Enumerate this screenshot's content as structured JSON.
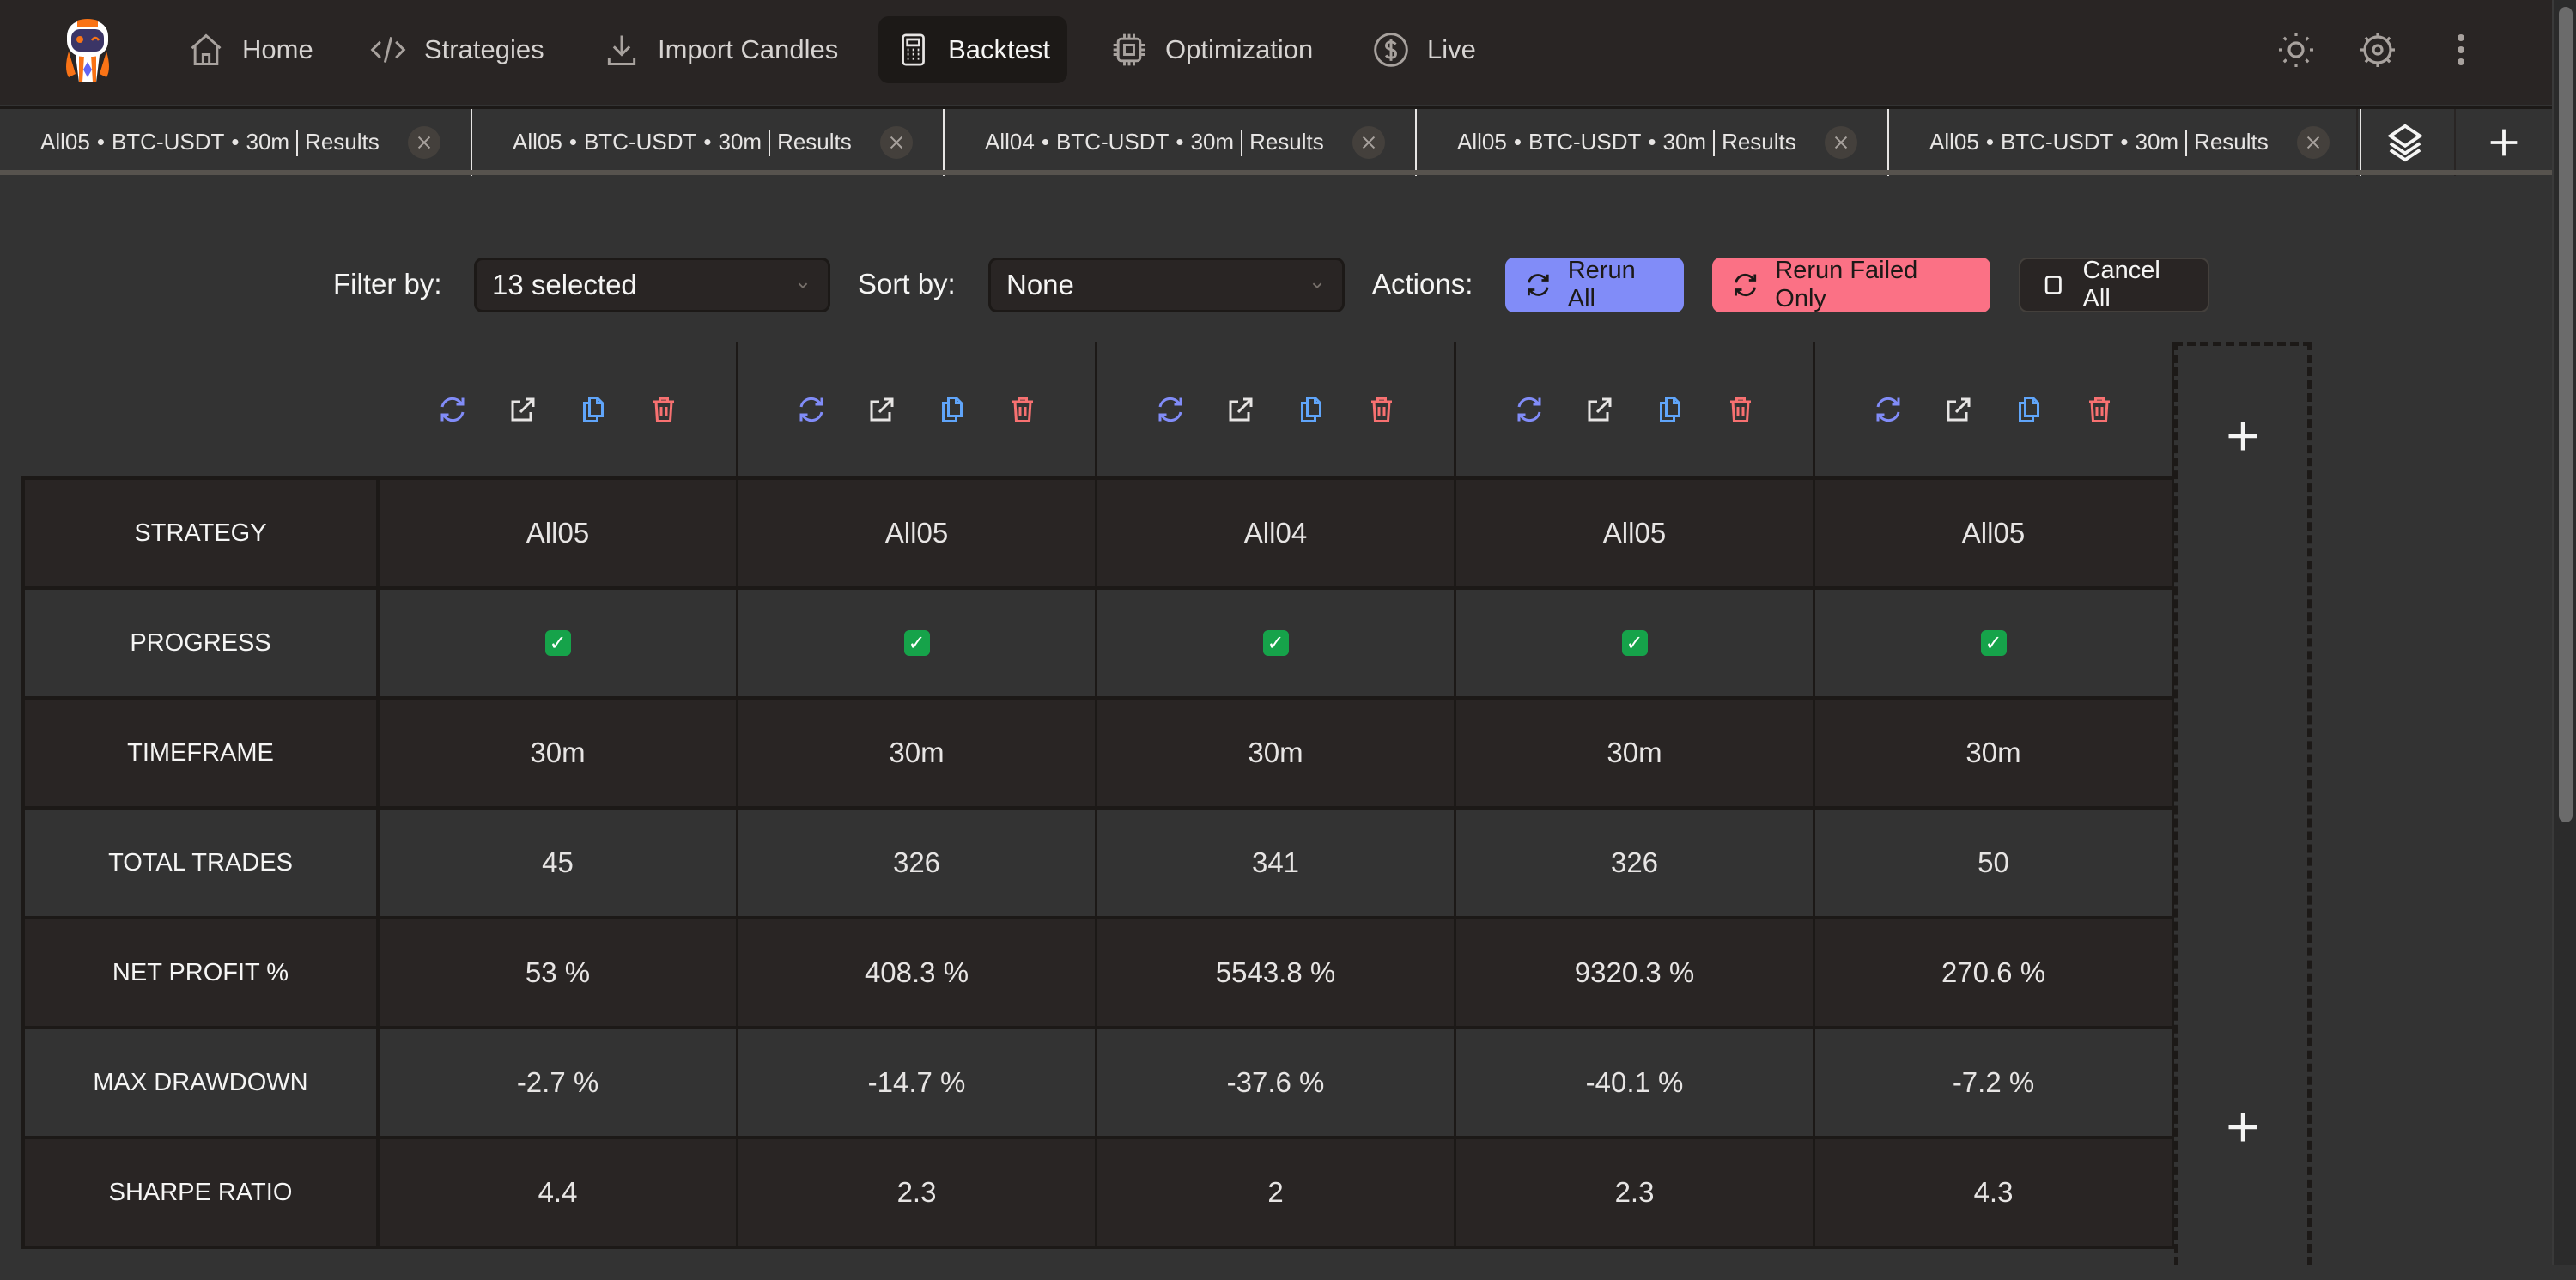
{
  "nav": {
    "items": [
      {
        "label": "Home",
        "icon": "home-icon"
      },
      {
        "label": "Strategies",
        "icon": "code-icon"
      },
      {
        "label": "Import Candles",
        "icon": "download-icon"
      },
      {
        "label": "Backtest",
        "icon": "calculator-icon",
        "active": true
      },
      {
        "label": "Optimization",
        "icon": "cpu-icon"
      },
      {
        "label": "Live",
        "icon": "dollar-icon"
      }
    ],
    "right_icons": [
      "sun-icon",
      "gear-icon",
      "more-vertical-icon"
    ]
  },
  "tabs": [
    {
      "strategy": "All05",
      "pair": "BTC-USDT",
      "timeframe": "30m",
      "view": "Results"
    },
    {
      "strategy": "All05",
      "pair": "BTC-USDT",
      "timeframe": "30m",
      "view": "Results"
    },
    {
      "strategy": "All04",
      "pair": "BTC-USDT",
      "timeframe": "30m",
      "view": "Results"
    },
    {
      "strategy": "All05",
      "pair": "BTC-USDT",
      "timeframe": "30m",
      "view": "Results"
    },
    {
      "strategy": "All05",
      "pair": "BTC-USDT",
      "timeframe": "30m",
      "view": "Results"
    }
  ],
  "tab_separator": "•",
  "controls": {
    "filter_label": "Filter by:",
    "filter_value": "13 selected",
    "sort_label": "Sort by:",
    "sort_value": "None",
    "actions_label": "Actions:",
    "rerun_all": "Rerun All",
    "rerun_failed": "Rerun Failed Only",
    "cancel_all": "Cancel All"
  },
  "colors": {
    "accent_blue": "#818cf8",
    "accent_red": "#fb7185",
    "copy_blue": "#60a5fa",
    "delete_red": "#f87171",
    "success_green": "#16a34a"
  },
  "table": {
    "row_labels": [
      "STRATEGY",
      "PROGRESS",
      "TIMEFRAME",
      "TOTAL TRADES",
      "NET PROFIT %",
      "MAX DRAWDOWN",
      "SHARPE RATIO"
    ],
    "columns": [
      {
        "strategy": "All05",
        "progress": "✓",
        "timeframe": "30m",
        "total_trades": "45",
        "net_profit": "53 %",
        "max_drawdown": "-2.7 %",
        "sharpe": "4.4"
      },
      {
        "strategy": "All05",
        "progress": "✓",
        "timeframe": "30m",
        "total_trades": "326",
        "net_profit": "408.3 %",
        "max_drawdown": "-14.7 %",
        "sharpe": "2.3"
      },
      {
        "strategy": "All04",
        "progress": "✓",
        "timeframe": "30m",
        "total_trades": "341",
        "net_profit": "5543.8 %",
        "max_drawdown": "-37.6 %",
        "sharpe": "2"
      },
      {
        "strategy": "All05",
        "progress": "✓",
        "timeframe": "30m",
        "total_trades": "326",
        "net_profit": "9320.3 %",
        "max_drawdown": "-40.1 %",
        "sharpe": "2.3"
      },
      {
        "strategy": "All05",
        "progress": "✓",
        "timeframe": "30m",
        "total_trades": "50",
        "net_profit": "270.6 %",
        "max_drawdown": "-7.2 %",
        "sharpe": "4.3"
      }
    ],
    "column_actions": [
      "refresh-icon",
      "open-external-icon",
      "copy-icon",
      "trash-icon"
    ]
  }
}
